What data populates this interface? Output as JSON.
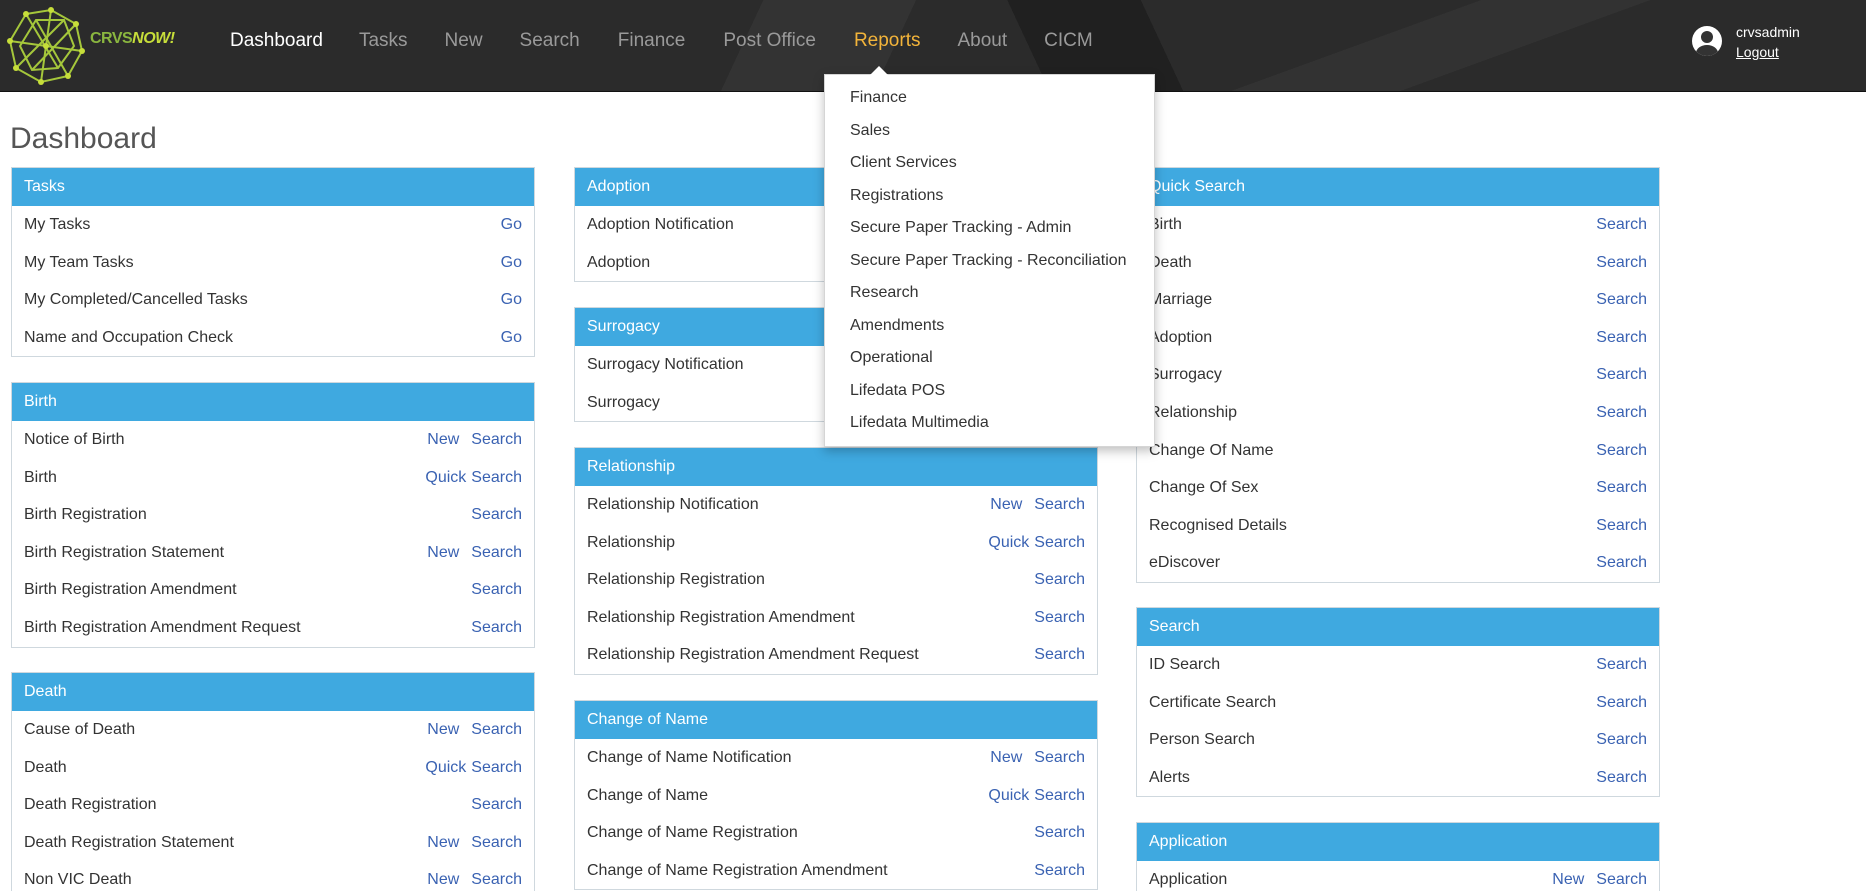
{
  "logo": {
    "text_part1": "CRVS",
    "text_part2": "NOW!"
  },
  "nav": [
    {
      "label": "Dashboard",
      "state": "active"
    },
    {
      "label": "Tasks",
      "state": ""
    },
    {
      "label": "New",
      "state": ""
    },
    {
      "label": "Search",
      "state": ""
    },
    {
      "label": "Finance",
      "state": ""
    },
    {
      "label": "Post Office",
      "state": ""
    },
    {
      "label": "Reports",
      "state": "hl"
    },
    {
      "label": "About",
      "state": ""
    },
    {
      "label": "CICM",
      "state": ""
    }
  ],
  "user": {
    "name": "crvsadmin",
    "logout": "Logout"
  },
  "page_title": "Dashboard",
  "reports_menu": [
    "Finance",
    "Sales",
    "Client Services",
    "Registrations",
    "Secure Paper Tracking - Admin",
    "Secure Paper Tracking - Reconciliation",
    "Research",
    "Amendments",
    "Operational",
    "Lifedata POS",
    "Lifedata Multimedia"
  ],
  "panels": {
    "tasks": {
      "title": "Tasks",
      "rows": [
        {
          "label": "My Tasks",
          "actions": [
            "Go"
          ]
        },
        {
          "label": "My Team Tasks",
          "actions": [
            "Go"
          ]
        },
        {
          "label": "My Completed/Cancelled Tasks",
          "actions": [
            "Go"
          ]
        },
        {
          "label": "Name and Occupation Check",
          "actions": [
            "Go"
          ]
        }
      ]
    },
    "birth": {
      "title": "Birth",
      "rows": [
        {
          "label": "Notice of Birth",
          "actions": [
            "New",
            "Search"
          ]
        },
        {
          "label": "Birth",
          "actions": [
            "Quick",
            "Search"
          ]
        },
        {
          "label": "Birth Registration",
          "actions": [
            "Search"
          ]
        },
        {
          "label": "Birth Registration Statement",
          "actions": [
            "New",
            "Search"
          ]
        },
        {
          "label": "Birth Registration Amendment",
          "actions": [
            "Search"
          ]
        },
        {
          "label": "Birth Registration Amendment Request",
          "actions": [
            "Search"
          ]
        }
      ]
    },
    "death": {
      "title": "Death",
      "rows": [
        {
          "label": "Cause of Death",
          "actions": [
            "New",
            "Search"
          ]
        },
        {
          "label": "Death",
          "actions": [
            "Quick",
            "Search"
          ]
        },
        {
          "label": "Death Registration",
          "actions": [
            "Search"
          ]
        },
        {
          "label": "Death Registration Statement",
          "actions": [
            "New",
            "Search"
          ]
        },
        {
          "label": "Non VIC Death",
          "actions": [
            "New",
            "Search"
          ]
        }
      ]
    },
    "adoption": {
      "title": "Adoption",
      "rows": [
        {
          "label": "Adoption Notification",
          "actions": []
        },
        {
          "label": "Adoption",
          "actions": []
        }
      ]
    },
    "surrogacy": {
      "title": "Surrogacy",
      "rows": [
        {
          "label": "Surrogacy Notification",
          "actions": []
        },
        {
          "label": "Surrogacy",
          "actions": []
        }
      ]
    },
    "relationship": {
      "title": "Relationship",
      "rows": [
        {
          "label": "Relationship Notification",
          "actions": [
            "New",
            "Search"
          ]
        },
        {
          "label": "Relationship",
          "actions": [
            "Quick",
            "Search"
          ]
        },
        {
          "label": "Relationship Registration",
          "actions": [
            "Search"
          ]
        },
        {
          "label": "Relationship Registration Amendment",
          "actions": [
            "Search"
          ]
        },
        {
          "label": "Relationship Registration Amendment Request",
          "actions": [
            "Search"
          ]
        }
      ]
    },
    "change_of_name": {
      "title": "Change of Name",
      "rows": [
        {
          "label": "Change of Name Notification",
          "actions": [
            "New",
            "Search"
          ]
        },
        {
          "label": "Change of Name",
          "actions": [
            "Quick",
            "Search"
          ]
        },
        {
          "label": "Change of Name Registration",
          "actions": [
            "Search"
          ]
        },
        {
          "label": "Change of Name Registration Amendment",
          "actions": [
            "Search"
          ]
        }
      ]
    },
    "quick_search": {
      "title": "Quick Search",
      "rows": [
        {
          "label": "Birth",
          "actions": [
            "Search"
          ]
        },
        {
          "label": "Death",
          "actions": [
            "Search"
          ]
        },
        {
          "label": "Marriage",
          "actions": [
            "Search"
          ]
        },
        {
          "label": "Adoption",
          "actions": [
            "Search"
          ]
        },
        {
          "label": "Surrogacy",
          "actions": [
            "Search"
          ]
        },
        {
          "label": "Relationship",
          "actions": [
            "Search"
          ]
        },
        {
          "label": "Change Of Name",
          "actions": [
            "Search"
          ]
        },
        {
          "label": "Change Of Sex",
          "actions": [
            "Search"
          ]
        },
        {
          "label": "Recognised Details",
          "actions": [
            "Search"
          ]
        },
        {
          "label": "eDiscover",
          "actions": [
            "Search"
          ]
        }
      ]
    },
    "search": {
      "title": "Search",
      "rows": [
        {
          "label": "ID Search",
          "actions": [
            "Search"
          ]
        },
        {
          "label": "Certificate Search",
          "actions": [
            "Search"
          ]
        },
        {
          "label": "Person Search",
          "actions": [
            "Search"
          ]
        },
        {
          "label": "Alerts",
          "actions": [
            "Search"
          ]
        }
      ]
    },
    "application": {
      "title": "Application",
      "rows": [
        {
          "label": "Application",
          "actions": [
            "New",
            "Search"
          ]
        }
      ]
    }
  },
  "colors": {
    "header_bg": "#2b2b2b",
    "panel_header": "#3fa9e0",
    "link": "#3a62b2",
    "nav_highlight": "#f3b43a",
    "logo_green": "#8ab63f"
  }
}
